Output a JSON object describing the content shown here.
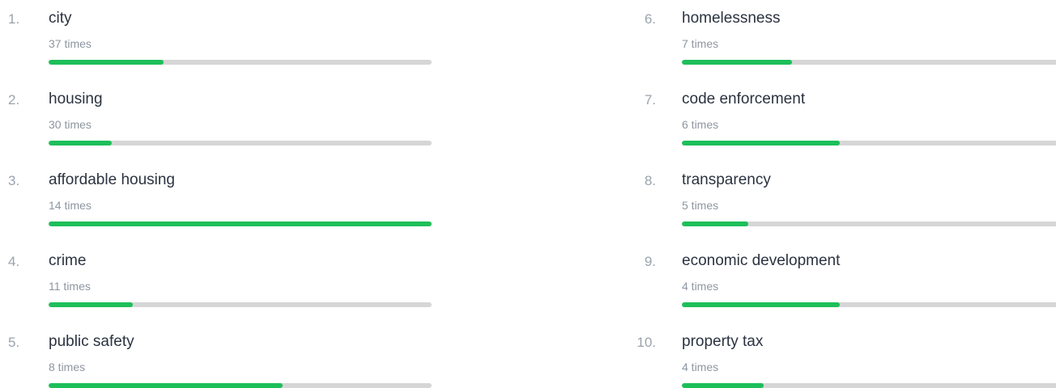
{
  "accent_color": "#1dbf5a",
  "track_color": "#d6d6d6",
  "items": [
    {
      "rank": "1.",
      "term": "city",
      "count": "37 times",
      "fill_fraction": 0.3
    },
    {
      "rank": "2.",
      "term": "housing",
      "count": "30 times",
      "fill_fraction": 0.165
    },
    {
      "rank": "3.",
      "term": "affordable housing",
      "count": "14 times",
      "fill_fraction": 1.0
    },
    {
      "rank": "4.",
      "term": "crime",
      "count": "11 times",
      "fill_fraction": 0.22
    },
    {
      "rank": "5.",
      "term": "public safety",
      "count": "8 times",
      "fill_fraction": 0.61
    },
    {
      "rank": "6.",
      "term": "homelessness",
      "count": "7 times",
      "fill_fraction": 0.29
    },
    {
      "rank": "7.",
      "term": "code enforcement",
      "count": "6 times",
      "fill_fraction": 0.415
    },
    {
      "rank": "8.",
      "term": "transparency",
      "count": "5 times",
      "fill_fraction": 0.175
    },
    {
      "rank": "9.",
      "term": "economic development",
      "count": "4 times",
      "fill_fraction": 0.415
    },
    {
      "rank": "10.",
      "term": "property tax",
      "count": "4 times",
      "fill_fraction": 0.215
    }
  ]
}
